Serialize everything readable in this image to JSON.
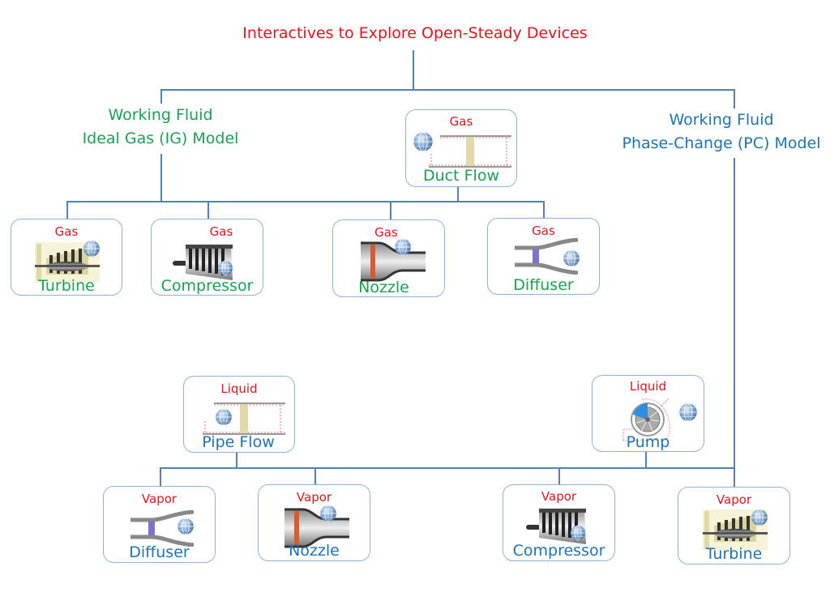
{
  "title": "Interactives to Explore Open-Steady Devices",
  "branches": {
    "ideal_gas": {
      "line1": "Working Fluid",
      "line2": "Ideal Gas (IG) Model",
      "color": "#17a352"
    },
    "phase_change": {
      "line1": "Working Fluid",
      "line2": "Phase-Change (PC) Model",
      "color": "#1a74bb"
    }
  },
  "colors": {
    "connector": "#4f81bd",
    "fluid_label": "#e8141c",
    "node_border": "#8eb4d9"
  },
  "ig_nodes": {
    "duct_flow": {
      "fluid": "Gas",
      "name": "Duct Flow",
      "icon": "duct-flow-icon"
    },
    "turbine": {
      "fluid": "Gas",
      "name": "Turbine",
      "icon": "turbine-icon"
    },
    "compressor": {
      "fluid": "Gas",
      "name": "Compressor",
      "icon": "compressor-icon"
    },
    "nozzle": {
      "fluid": "Gas",
      "name": "Nozzle",
      "icon": "nozzle-icon"
    },
    "diffuser": {
      "fluid": "Gas",
      "name": "Diffuser",
      "icon": "diffuser-icon"
    }
  },
  "pc_nodes": {
    "pipe_flow": {
      "fluid": "Liquid",
      "name": "Pipe Flow",
      "icon": "pipe-flow-icon"
    },
    "pump": {
      "fluid": "Liquid",
      "name": "Pump",
      "icon": "pump-icon"
    },
    "diffuser": {
      "fluid": "Vapor",
      "name": "Diffuser",
      "icon": "diffuser-icon"
    },
    "nozzle": {
      "fluid": "Vapor",
      "name": "Nozzle",
      "icon": "nozzle-icon"
    },
    "compressor": {
      "fluid": "Vapor",
      "name": "Compressor",
      "icon": "compressor-icon"
    },
    "turbine": {
      "fluid": "Vapor",
      "name": "Turbine",
      "icon": "turbine-icon"
    }
  }
}
